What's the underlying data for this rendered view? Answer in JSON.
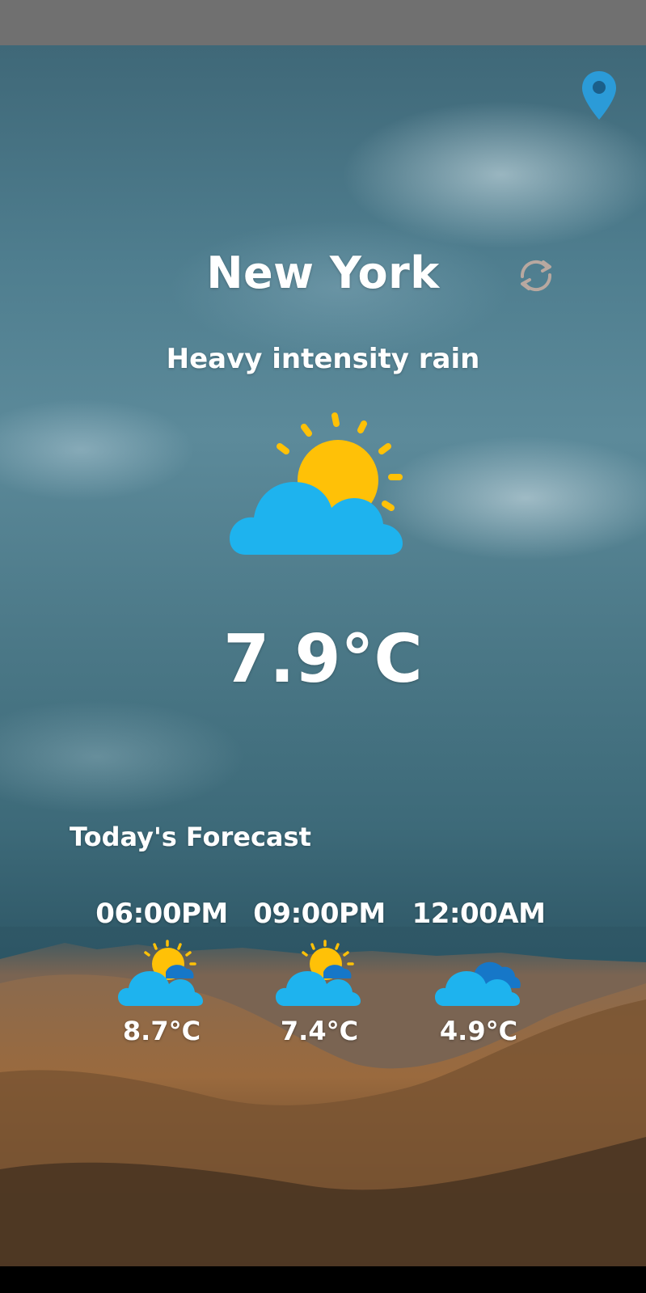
{
  "app": {
    "city": "New York",
    "description": "Heavy intensity rain",
    "current_temp": "7.9°C",
    "current_icon": "partly-cloudy-sun-icon"
  },
  "actions": {
    "location_icon": "location-pin-icon",
    "refresh_icon": "refresh-icon"
  },
  "forecast": {
    "title": "Today's Forecast",
    "items": [
      {
        "time": "06:00PM",
        "icon": "partly-cloudy-sun-icon",
        "temp": "8.7°C"
      },
      {
        "time": "09:00PM",
        "icon": "partly-cloudy-sun-icon",
        "temp": "7.4°C"
      },
      {
        "time": "12:00AM",
        "icon": "cloudy-icon",
        "temp": "4.9°C"
      }
    ]
  },
  "colors": {
    "sun": "#FFC107",
    "cloud": "#1EB3EE",
    "cloud_dark": "#1677C8",
    "pin": "#2B9BD8",
    "text": "#FFFFFF"
  }
}
